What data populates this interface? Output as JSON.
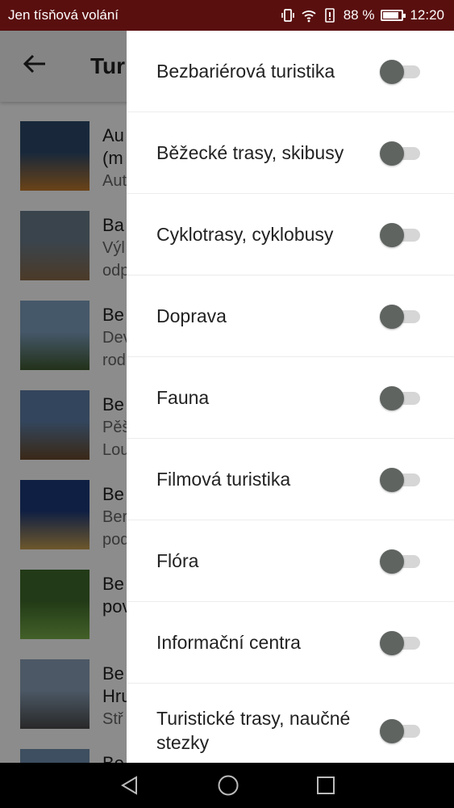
{
  "status_bar": {
    "carrier": "Jen tísňová volání",
    "battery": "88 %",
    "battery_level": 0.88,
    "time": "12:20",
    "background": "#5a0f0f"
  },
  "app": {
    "title": "Tur",
    "items": [
      {
        "title": "Au",
        "title2": "(m",
        "sub": "Aut"
      },
      {
        "title": "Ba",
        "sub": "Výl",
        "sub2": "odp"
      },
      {
        "title": "Be",
        "sub": "Dev",
        "sub2": "rod"
      },
      {
        "title": "Be",
        "sub": "Pěš",
        "sub2": "Lou"
      },
      {
        "title": "Be",
        "sub": "Ber",
        "sub2": "pod"
      },
      {
        "title": "Be",
        "title2": "pov"
      },
      {
        "title": "Be",
        "title2": "Hru",
        "sub": "Stř"
      },
      {
        "title": "Be"
      }
    ]
  },
  "drawer": {
    "filters": [
      {
        "label": "Bezbariérová turistika",
        "on": false
      },
      {
        "label": "Běžecké trasy, skibusy",
        "on": false
      },
      {
        "label": "Cyklotrasy, cyklobusy",
        "on": false
      },
      {
        "label": "Doprava",
        "on": false
      },
      {
        "label": "Fauna",
        "on": false
      },
      {
        "label": "Filmová turistika",
        "on": false
      },
      {
        "label": "Flóra",
        "on": false
      },
      {
        "label": "Informační centra",
        "on": false
      },
      {
        "label": "Turistické trasy, naučné stezky",
        "on": false
      }
    ]
  },
  "navbar": {
    "icons": [
      "back-triangle-icon",
      "home-circle-icon",
      "recents-square-icon"
    ]
  }
}
